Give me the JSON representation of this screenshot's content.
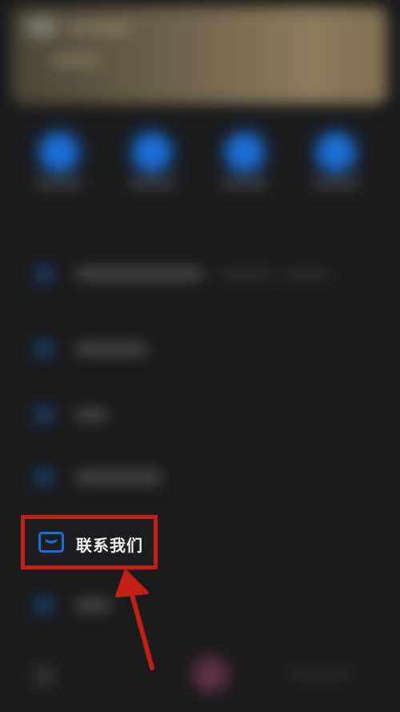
{
  "menu": {
    "highlighted_item": {
      "label": "联系我们",
      "icon": "message-box-icon"
    }
  },
  "colors": {
    "highlight_border": "#c21f17",
    "arrow": "#c21f17",
    "icon_blue": "#1a6ed8",
    "background": "#1b1b1c",
    "label_text": "#f2f2f2"
  }
}
